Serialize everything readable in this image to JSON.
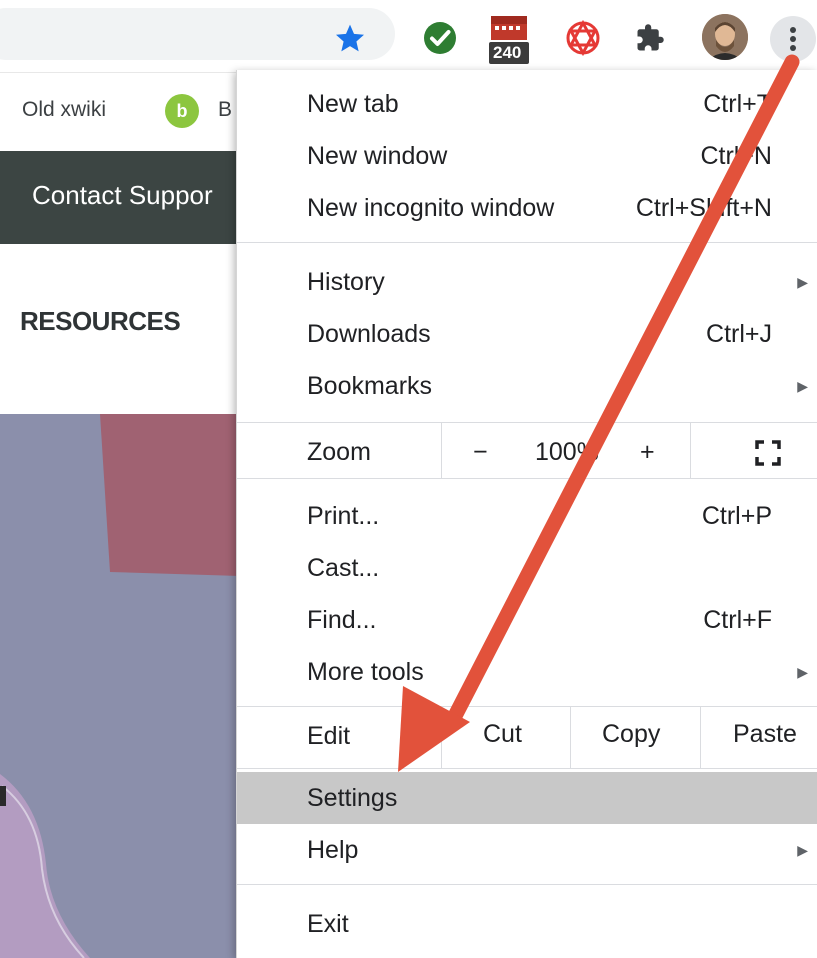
{
  "toolbar": {
    "ext_badge": "240"
  },
  "page": {
    "bookmark_label": "Old xwiki",
    "bookmark_icon_glyph": "b",
    "bookmark_truncated": "B",
    "contact_button": "Contact Suppor",
    "section_heading": "RESOURCES"
  },
  "menu": {
    "new_tab": {
      "label": "New tab",
      "shortcut": "Ctrl+T"
    },
    "new_window": {
      "label": "New window",
      "shortcut": "Ctrl+N"
    },
    "new_incognito": {
      "label": "New incognito window",
      "shortcut": "Ctrl+Shift+N"
    },
    "history": {
      "label": "History"
    },
    "downloads": {
      "label": "Downloads",
      "shortcut": "Ctrl+J"
    },
    "bookmarks": {
      "label": "Bookmarks"
    },
    "zoom": {
      "label": "Zoom",
      "minus": "−",
      "value": "100%",
      "plus": "+"
    },
    "print": {
      "label": "Print...",
      "shortcut": "Ctrl+P"
    },
    "cast": {
      "label": "Cast..."
    },
    "find": {
      "label": "Find...",
      "shortcut": "Ctrl+F"
    },
    "more_tools": {
      "label": "More tools"
    },
    "edit": {
      "label": "Edit",
      "cut": "Cut",
      "copy": "Copy",
      "paste": "Paste"
    },
    "settings": {
      "label": "Settings"
    },
    "help": {
      "label": "Help"
    },
    "exit": {
      "label": "Exit"
    }
  },
  "colors": {
    "accent_arrow": "#e2523b",
    "highlight": "#c8c8c8",
    "contact_bar": "#3c4543"
  }
}
